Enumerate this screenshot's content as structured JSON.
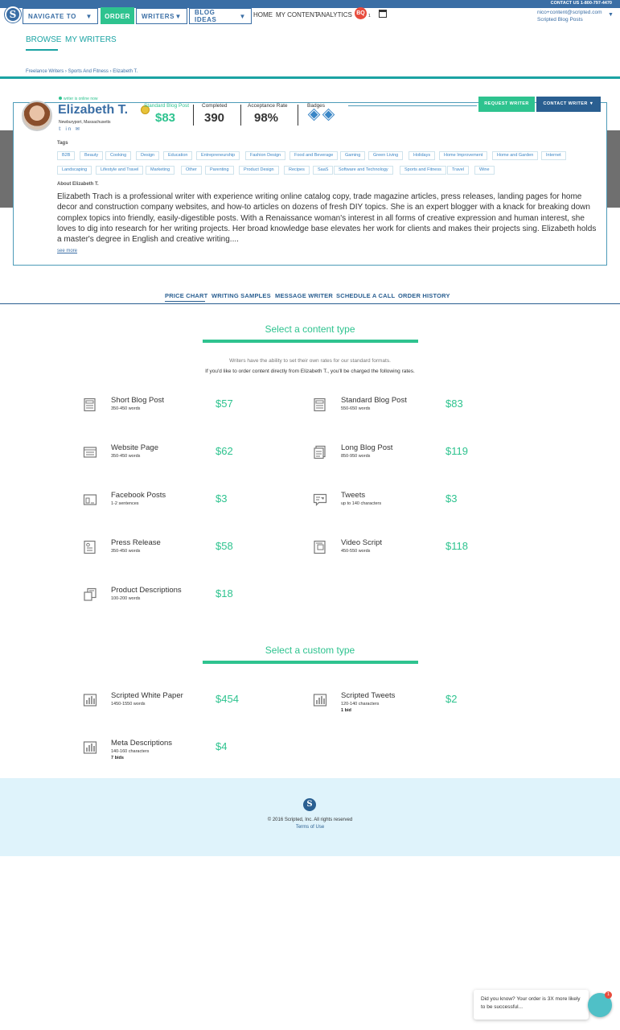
{
  "header": {
    "contact_us": "CONTACT US 1-800-797-4470",
    "logo": "S",
    "navigate_to": "NAVIGATE TO",
    "order": "ORDER",
    "writers": "WRITERS",
    "blog_ideas": "BLOG IDEAS",
    "links": [
      "HOME",
      "MY CONTENT",
      "ANALYTICS"
    ],
    "notif_icon_text": "BQ",
    "notif_count": "1",
    "user_email": "nico+content@scripted.com",
    "user_plan": "Scripted Blog Posts"
  },
  "browse_tabs": [
    "BROWSE",
    "MY WRITERS"
  ],
  "breadcrumb": "Freelance Writers › Sports And Fitness › Elizabeth T.",
  "profile": {
    "online": "writer is online now",
    "name": "Elizabeth T.",
    "location": "Newburyport, Massachusetts",
    "socials": "𝕥 in ✉",
    "stats": {
      "standard_label": "Standard Blog Post",
      "standard_value": "$83",
      "completed_label": "Completed",
      "completed_value": "390",
      "acceptance_label": "Acceptance Rate",
      "acceptance_value": "98%",
      "badges_label": "Badges"
    },
    "request_writer": "REQUEST WRITER",
    "contact_writer": "CONTACT WRITER ▼",
    "tags_title": "Tags",
    "tags_row1": [
      "B2B",
      "Beauty",
      "Cooking",
      "Design",
      "Education",
      "Entrepreneurship",
      "Fashion Design",
      "Food and Beverage",
      "Gaming",
      "Green Living",
      "Holidays",
      "Home Improvement",
      "Home and Garden",
      "Internet"
    ],
    "tags_row2": [
      "Landscaping",
      "Lifestyle and Travel",
      "Marketing",
      "Other",
      "Parenting",
      "Product Design",
      "Recipes",
      "SaaS",
      "Software and Technology",
      "Sports and Fitness",
      "Travel",
      "Wine"
    ],
    "about_title": "About Elizabeth T.",
    "about_text": "Elizabeth Trach is a professional writer with experience writing online catalog copy, trade magazine articles, press releases, landing pages for home decor and construction company websites, and how-to articles on dozens of fresh DIY topics. She is an expert blogger with a knack for breaking down complex topics into friendly, easily-digestible posts. With a Renaissance woman's interest in all forms of creative expression and human interest, she loves to dig into research for her writing projects. Her broad knowledge base elevates her work for clients and makes their projects sing. Elizabeth holds a master's degree in English and creative writing....",
    "see_more": "see more"
  },
  "subtabs": [
    "PRICE CHART",
    "WRITING SAMPLES",
    "MESSAGE WRITER",
    "SCHEDULE A CALL",
    "ORDER HISTORY"
  ],
  "content_section": {
    "title": "Select a content type",
    "info1": "Writers have the ability to set their own rates for our standard formats.",
    "info2": "If you'd like to order content directly from Elizabeth T., you'll be charged the following rates.",
    "items": [
      {
        "name": "Short Blog Post",
        "sub": "350-450 words",
        "price": "$57",
        "icon": "blog-post-icon"
      },
      {
        "name": "Standard Blog Post",
        "sub": "550-650 words",
        "price": "$83",
        "icon": "blog-post-icon"
      },
      {
        "name": "Website Page",
        "sub": "350-450 words",
        "price": "$62",
        "icon": "website-page-icon"
      },
      {
        "name": "Long Blog Post",
        "sub": "850-950 words",
        "price": "$119",
        "icon": "long-post-icon"
      },
      {
        "name": "Facebook Posts",
        "sub": "1-2 sentences",
        "price": "$3",
        "icon": "facebook-icon"
      },
      {
        "name": "Tweets",
        "sub": "up to 140 characters",
        "price": "$3",
        "icon": "tweet-icon"
      },
      {
        "name": "Press Release",
        "sub": "350-450 words",
        "price": "$58",
        "icon": "press-release-icon"
      },
      {
        "name": "Video Script",
        "sub": "450-550 words",
        "price": "$118",
        "icon": "video-script-icon"
      },
      {
        "name": "Product Descriptions",
        "sub": "100-200 words",
        "price": "$18",
        "icon": "product-description-icon"
      }
    ]
  },
  "custom_section": {
    "title": "Select a custom type",
    "items": [
      {
        "name": "Scripted White Paper",
        "sub": "1450-1550 words",
        "bids": "",
        "price": "$454",
        "icon": "bar-chart-icon"
      },
      {
        "name": "Scripted Tweets",
        "sub": "120-140 characters",
        "bids": "1 bid",
        "price": "$2",
        "icon": "bar-chart-icon"
      },
      {
        "name": "Meta Descriptions",
        "sub": "140-160 characters",
        "bids": "7 bids",
        "price": "$4",
        "icon": "bar-chart-icon"
      }
    ]
  },
  "footer": {
    "logo": "S",
    "copyright": "© 2016 Scripted, Inc. All rights reserved",
    "terms": "Terms of Use"
  },
  "chat": {
    "message": "Did you know? Your order is 3X more likely to be successful...",
    "badge": "1"
  },
  "colors": {
    "brand_blue": "#3a6ea5",
    "accent_green": "#2ec38f",
    "teal": "#1aa3a3",
    "footer_bg": "#dff3fb"
  }
}
